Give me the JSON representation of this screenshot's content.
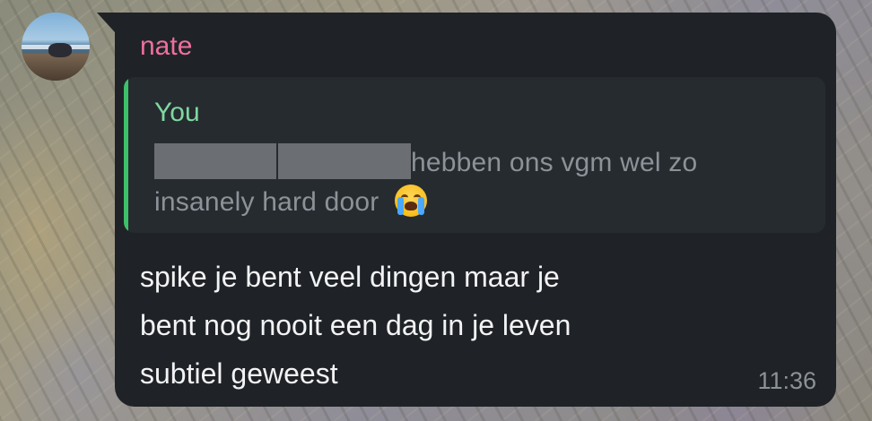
{
  "message": {
    "sender": "nate",
    "sender_color": "#ee6f9d",
    "avatar_icon": "beach-photo-avatar",
    "reply": {
      "author": "You",
      "author_color": "#7fd8a0",
      "bar_color": "#3ec06b",
      "text_line1": "hebben ons vgm wel zo",
      "text_line2": "insanely hard door",
      "emoji": "loudly-crying-face"
    },
    "text_line1": "spike je bent veel dingen maar je",
    "text_line2": "bent nog nooit een dag in je leven",
    "text_line3": "subtiel geweest",
    "time": "11:36"
  }
}
